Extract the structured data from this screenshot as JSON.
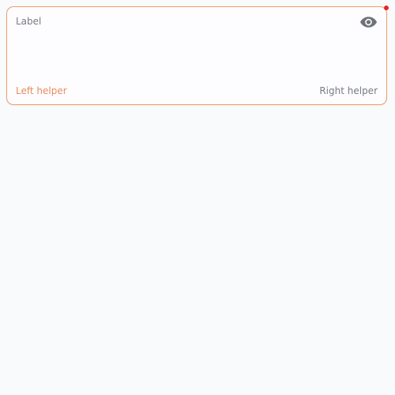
{
  "field": {
    "label": "Label",
    "value": "",
    "left_helper": "Left helper",
    "right_helper": "Right helper",
    "trailing_icon": "eye-icon",
    "required": true
  },
  "colors": {
    "border": "#f29a6c",
    "left_helper": "#ec8a5f",
    "muted_text": "#777b80",
    "required_dot": "#e5252b",
    "background": "#f9fafb"
  }
}
